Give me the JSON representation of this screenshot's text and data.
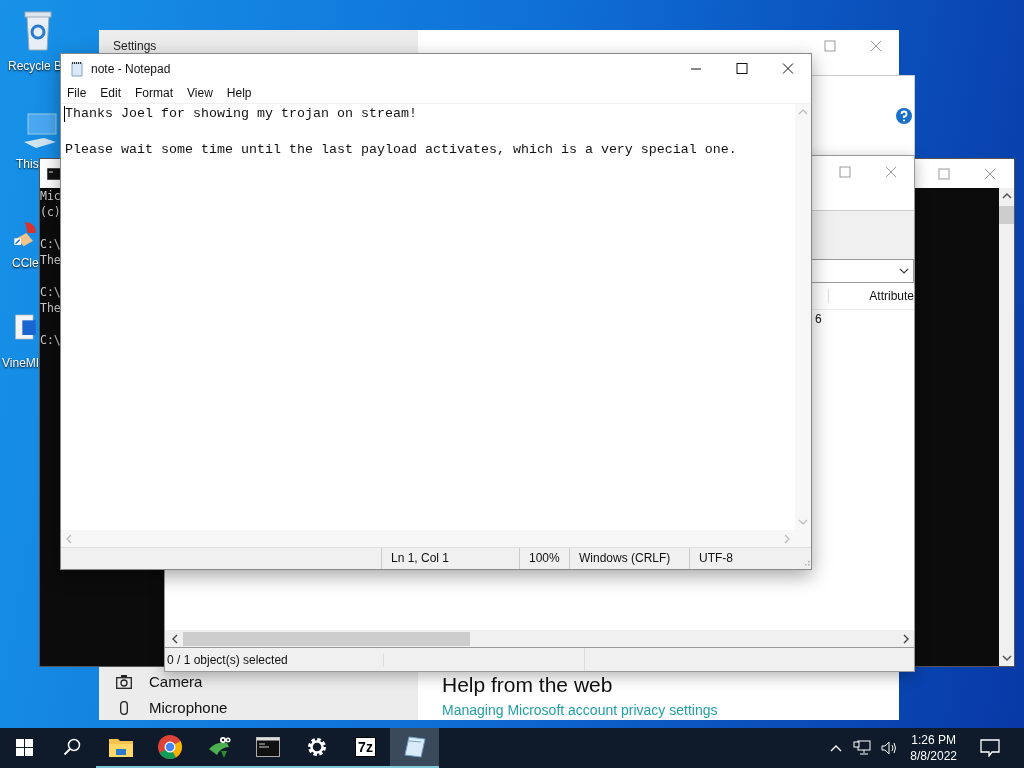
{
  "desktop": {
    "icons": [
      {
        "kind": "recycle",
        "label": "Recycle B"
      },
      {
        "kind": "computer",
        "label": "This"
      },
      {
        "kind": "cleaner",
        "label": "CCle"
      },
      {
        "kind": "installer",
        "label": "VineMI"
      }
    ]
  },
  "settings": {
    "title": "Settings",
    "nav_items": [
      {
        "kind": "camera",
        "label": "Camera"
      },
      {
        "kind": "microphone",
        "label": "Microphone"
      }
    ],
    "help_heading": "Help from the web",
    "help_link": "Managing Microsoft account privacy settings"
  },
  "console": {
    "groups": [
      [
        "Mic",
        "(c)"
      ],
      [
        "C:\\",
        "The"
      ],
      [
        "C:\\",
        "The"
      ],
      [
        "C:\\"
      ]
    ]
  },
  "archive": {
    "column_header": "Attribute",
    "cell": "6",
    "status": "0 / 1 object(s) selected"
  },
  "notepad": {
    "title": "note - Notepad",
    "menu": [
      "File",
      "Edit",
      "Format",
      "View",
      "Help"
    ],
    "lines": [
      "Thanks Joel for showing my trojan on stream!",
      "Please wait some time until the last payload activates, which is a very special one."
    ],
    "status": [
      "Ln 1, Col 1",
      "100%",
      "Windows (CRLF)",
      "UTF-8"
    ]
  },
  "taskbar": {
    "apps": [
      {
        "kind": "explorer",
        "active": false
      },
      {
        "kind": "chrome",
        "active": false
      },
      {
        "kind": "frog",
        "active": false
      },
      {
        "kind": "terminal",
        "active": false
      },
      {
        "kind": "settings",
        "active": false
      },
      {
        "kind": "archiver",
        "label": "7z",
        "active": false
      },
      {
        "kind": "notepad",
        "active": true
      }
    ],
    "time": "1:26 PM",
    "date": "8/8/2022"
  }
}
